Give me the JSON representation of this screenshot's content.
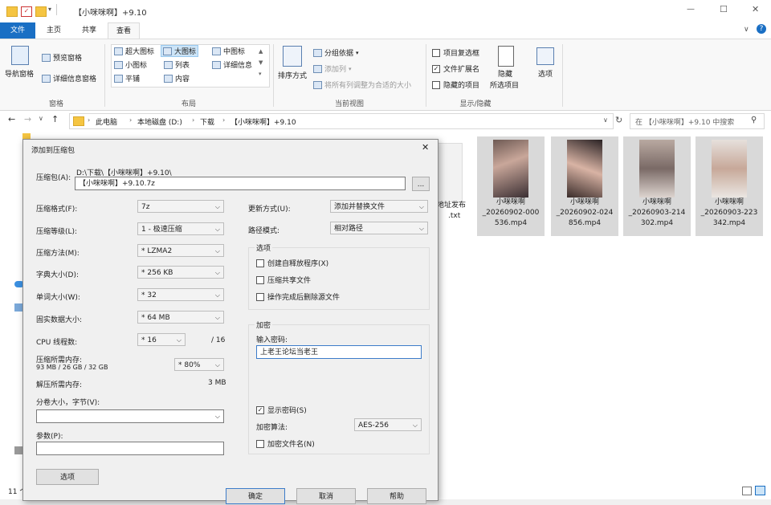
{
  "window": {
    "title": "【小咪咪啊】+9.10",
    "minimize_glyph": "—",
    "maximize_glyph": "☐",
    "close_glyph": "✕"
  },
  "menu": {
    "file": "文件",
    "home": "主页",
    "share": "共享",
    "view": "查看"
  },
  "ribbon": {
    "pane": {
      "nav_pane": "导航窗格",
      "preview_pane": "预览窗格",
      "details_pane": "详细信息窗格",
      "group_label": "窗格"
    },
    "layout": {
      "xl_icons": "超大图标",
      "large_icons": "大图标",
      "medium_icons": "中图标",
      "small_icons": "小图标",
      "list": "列表",
      "details": "详细信息",
      "tiles": "平铺",
      "content": "内容",
      "group_label": "布局"
    },
    "current_view": {
      "sort_by": "排序方式",
      "group_by": "分组依据",
      "add_column": "添加列",
      "fit_columns": "将所有列调整为合适的大小",
      "group_label": "当前视图"
    },
    "show_hide": {
      "item_checkboxes": "项目复选框",
      "file_ext": "文件扩展名",
      "hidden_items": "隐藏的项目",
      "hide_selected": "隐藏",
      "hide_selected2": "所选项目",
      "options": "选项",
      "group_label": "显示/隐藏"
    }
  },
  "address": {
    "crumbs": [
      "此电脑",
      "本地磁盘 (D:)",
      "下载",
      "【小咪咪啊】+9.10"
    ],
    "search_placeholder": "在 【小咪咪啊】+9.10 中搜索"
  },
  "files": [
    {
      "line1": "小咪咪啊",
      "line2": "_20260902-000",
      "line3": "536.mp4"
    },
    {
      "line1": "小咪咪啊",
      "line2": "_20260902-024",
      "line3": "856.mp4"
    },
    {
      "line1": "小咪咪啊",
      "line2": "_20260903-214",
      "line3": "302.mp4"
    },
    {
      "line1": "小咪咪啊",
      "line2": "_20260903-223",
      "line3": "342.mp4"
    }
  ],
  "partial_file": {
    "line1": "地址发布",
    "line2": ".txt"
  },
  "status": {
    "count": "11 个"
  },
  "dialog": {
    "title": "添加到压缩包",
    "archive_label": "压缩包(A):",
    "archive_path": "D:\\下载\\【小咪咪啊】+9.10\\",
    "archive_name": "【小咪咪啊】+9.10.7z",
    "browse": "...",
    "format_label": "压缩格式(F):",
    "format_value": "7z",
    "level_label": "压缩等级(L):",
    "level_value": "1 - 极速压缩",
    "method_label": "压缩方法(M):",
    "method_value": "* LZMA2",
    "dict_label": "字典大小(D):",
    "dict_value": "* 256 KB",
    "word_label": "单词大小(W):",
    "word_value": "* 32",
    "solid_label": "固实数据大小:",
    "solid_value": "* 64 MB",
    "cpu_label": "CPU 线程数:",
    "cpu_value": "* 16",
    "cpu_total": "/ 16",
    "mem_comp_label": "压缩所需内存:",
    "mem_comp_detail": "93 MB / 26 GB / 32 GB",
    "mem_comp_value": "* 80%",
    "mem_decomp_label": "解压所需内存:",
    "mem_decomp_value": "3 MB",
    "split_label": "分卷大小，字节(V):",
    "params_label": "参数(P):",
    "options_button": "选项",
    "update_label": "更新方式(U):",
    "update_value": "添加并替换文件",
    "path_label": "路径模式:",
    "path_value": "相对路径",
    "options_group": "选项",
    "opt_sfx": "创建自释放程序(X)",
    "opt_shared": "压缩共享文件",
    "opt_delete": "操作完成后删除源文件",
    "encrypt_group": "加密",
    "password_label": "输入密码:",
    "password_value": "上老王论坛当老王",
    "show_password": "显示密码(S)",
    "enc_method_label": "加密算法:",
    "enc_method_value": "AES-256",
    "encrypt_names": "加密文件名(N)",
    "ok": "确定",
    "cancel": "取消",
    "help": "帮助"
  }
}
